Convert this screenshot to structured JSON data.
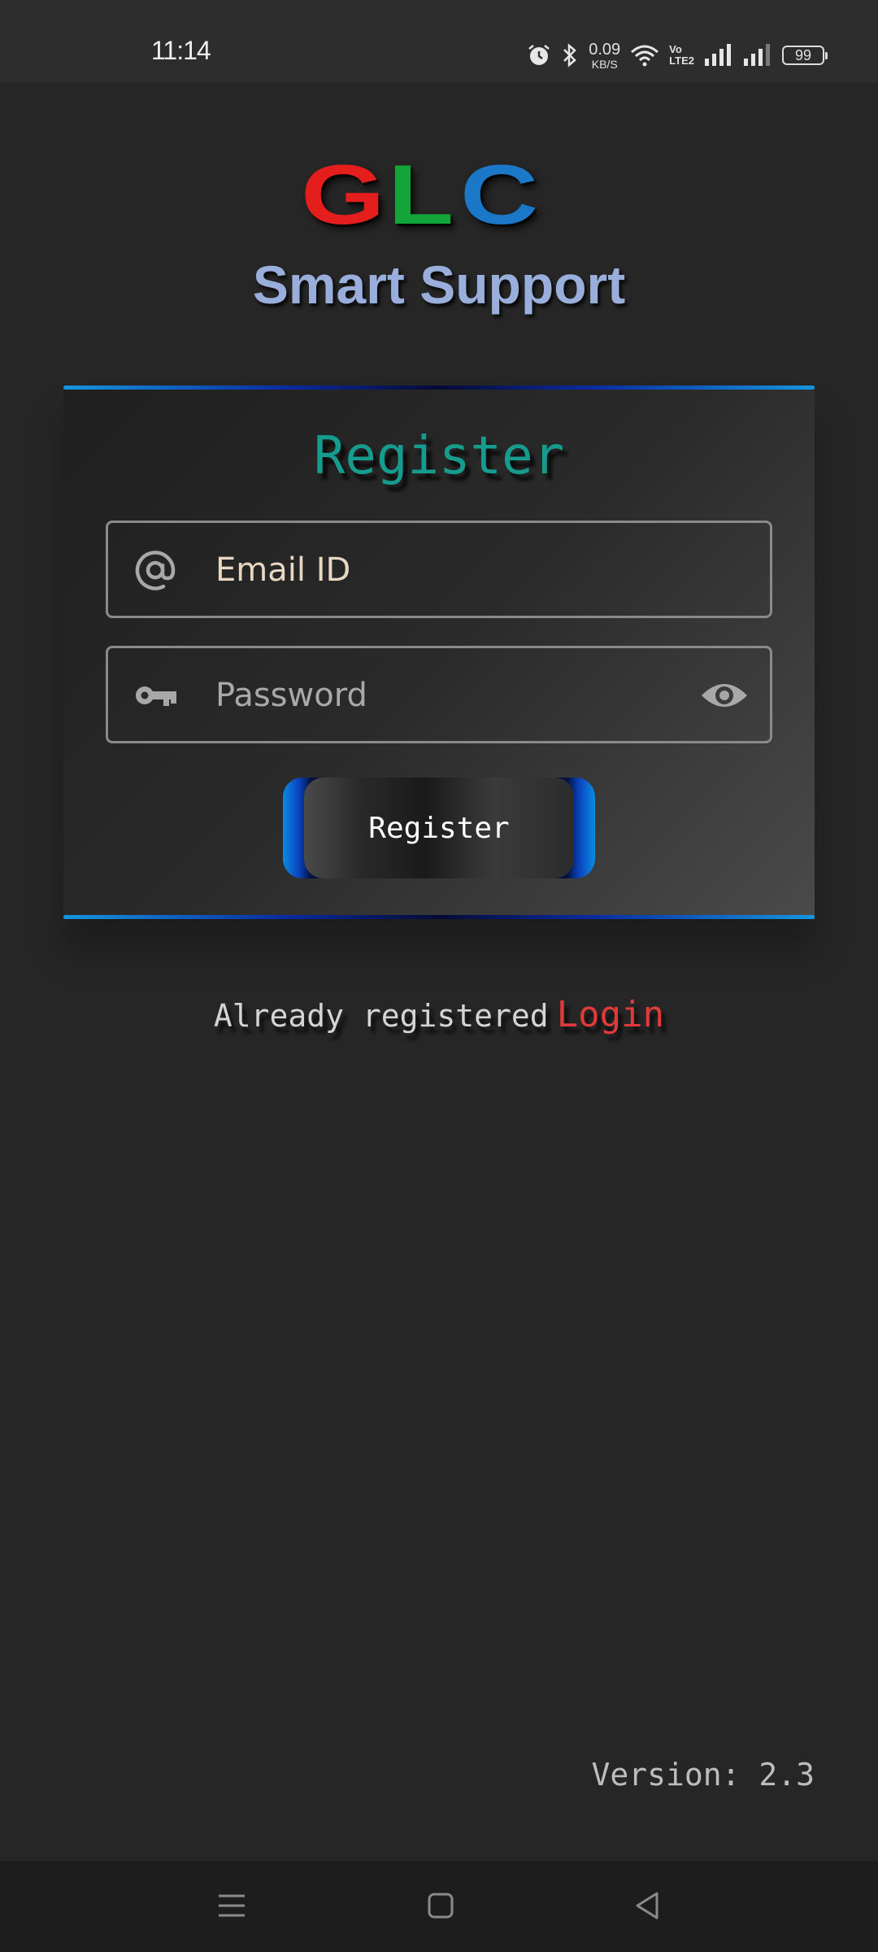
{
  "status_bar": {
    "time": "11:14",
    "net_speed_value": "0.09",
    "net_speed_unit": "KB/S",
    "volte_top": "Vo",
    "volte_bottom": "LTE2",
    "battery": "99",
    "icons": [
      "alarm-icon",
      "bluetooth-icon",
      "wifi-icon",
      "signal-icon",
      "signal-icon",
      "battery-icon"
    ]
  },
  "logo": {
    "letters": [
      "G",
      "L",
      "C"
    ],
    "colors": {
      "g": "#e41d1d",
      "l": "#13a53a",
      "c": "#1b78c8"
    },
    "tagline": "Smart Support"
  },
  "form": {
    "title": "Register",
    "email_placeholder": "Email ID",
    "password_placeholder": "Password",
    "submit_label": "Register",
    "icons": {
      "email": "at-icon",
      "password": "key-icon",
      "toggle": "eye-icon"
    }
  },
  "footer": {
    "login_prompt": "Already registered",
    "login_link": "Login",
    "version": "Version: 2.3"
  },
  "colors": {
    "background": "#262626",
    "title_accent": "#169c8e",
    "login_link": "#e23a3a",
    "border_accent": "#1596e0"
  },
  "nav_bar": {
    "icons": [
      "menu-icon",
      "home-icon",
      "back-icon"
    ]
  }
}
